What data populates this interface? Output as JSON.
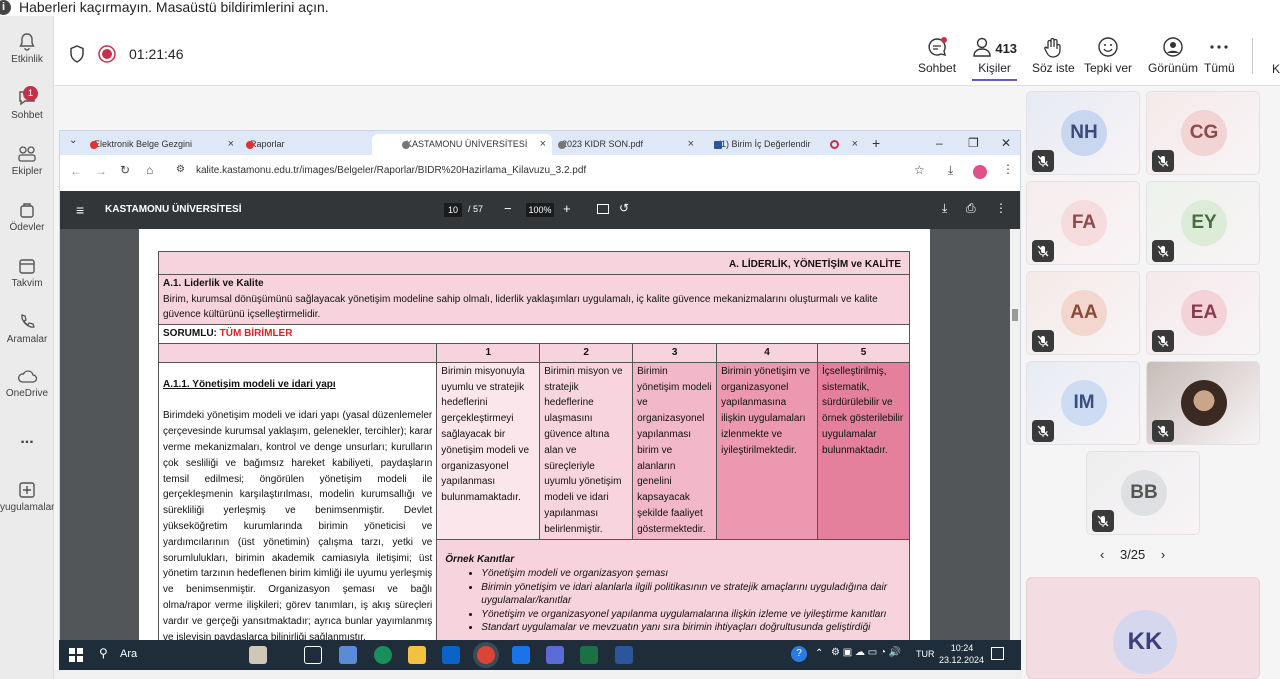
{
  "notification": {
    "text": "Haberleri kaçırmayın. Masaüstü bildirimlerini açın."
  },
  "rail": {
    "items": [
      {
        "label": "Etkinlik"
      },
      {
        "label": "Sohbet",
        "badge": "1"
      },
      {
        "label": "Ekipler"
      },
      {
        "label": "Ödevler"
      },
      {
        "label": "Takvim"
      },
      {
        "label": "Aramalar"
      },
      {
        "label": "OneDrive"
      },
      {
        "label": "..."
      },
      {
        "label": "yugulamalar"
      }
    ]
  },
  "meeting": {
    "timer": "01:21:46",
    "people_count": "413",
    "tools": [
      "Sohbet",
      "Kişiler",
      "Söz iste",
      "Tepki ver",
      "Görünüm",
      "Tümü"
    ],
    "overflow": "K"
  },
  "browser": {
    "tabs": [
      {
        "label": "Elektronik Belge Gezgini",
        "x": "×"
      },
      {
        "label": "Raporlar",
        "x": "×"
      },
      {
        "label": "KASTAMONU ÜNİVERSİTESİ",
        "x": "×"
      },
      {
        "label": "2023 KIDR SON.pdf",
        "x": "×"
      },
      {
        "label": "(1) Birim İç Değerlendir",
        "x": "×"
      }
    ],
    "new_tab": "+",
    "url": "kalite.kastamonu.edu.tr/images/Belgeler/Raporlar/BIDR%20Hazirlama_Kilavuzu_3.2.pdf",
    "window_controls": [
      "–",
      "❐",
      "✕"
    ]
  },
  "pdf": {
    "title": "KASTAMONU ÜNİVERSİTESİ",
    "page_current": "10",
    "page_total": "/ 57",
    "zoom": "100%",
    "section_header": "A. LİDERLİK, YÖNETİŞİM ve KALİTE",
    "subsection_title": "A.1. Liderlik ve Kalite",
    "subsection_desc": "Birim, kurumsal dönüşümünü sağlayacak yönetişim modeline sahip olmalı, liderlik yaklaşımları uygulamalı, iç kalite güvence mekanizmalarını oluşturmalı ve kalite güvence kültürünü içselleştirmelidir.",
    "responsible_label": "SORUMLU:",
    "responsible_value": "TÜM BİRİMLER",
    "levels": [
      "1",
      "2",
      "3",
      "4",
      "5"
    ],
    "criterion_title": "A.1.1. Yönetişim modeli ve idari yapı",
    "criterion_text": "Birimdeki yönetişim modeli ve idari yapı (yasal düzenlemeler çerçevesinde kurumsal yaklaşım, gelenekler, tercihler); karar verme mekanizmaları, kontrol ve denge unsurları; kurulların çok sesliliği ve bağımsız hareket kabiliyeti, paydaşların temsil edilmesi; öngörülen yönetişim modeli ile gerçekleşmenin karşılaştırılması, modelin kurumsallığı ve sürekliliği yerleşmiş ve benimsenmiştir. Devlet yükseköğretim kurumlarında birimin yöneticisi ve yardımcılarının (üst yönetimin) çalışma tarzı, yetki ve sorumlulukları, birimin akademik camiasıyla iletişimi; üst yönetim tarzının hedeflenen birim kimliği ile uyumu yerleşmiş ve benimsenmiştir. Organizasyon şeması ve bağlı olma/rapor verme ilişkileri; görev tanımları, iş akış süreçleri vardır ve gerçeği yansıtmaktadır; ayrıca bunlar yayımlanmış ve işleyişin paydaşlarca bilinirliği sağlanmıştır.",
    "level_texts": [
      "Birimin misyonuyla uyumlu ve stratejik hedeflerini gerçekleştirmeyi sağlayacak bir yönetişim modeli ve organizasyonel yapılanması bulunmamaktadır.",
      "Birimin misyon ve stratejik hedeflerine ulaşmasını güvence altına alan ve süreçleriyle uyumlu yönetişim modeli ve idari yapılanması belirlenmiştir.",
      "Birimin yönetişim modeli ve organizasyonel yapılanması birim ve alanların genelini kapsayacak şekilde faaliyet göstermektedir.",
      "Birimin yönetişim ve organizasyonel yapılanmasına ilişkin uygulamaları izlenmekte ve iyileştirilmektedir.",
      "İçselleştirilmiş, sistematik, sürdürülebilir ve örnek gösterilebilir uygulamalar bulunmaktadır."
    ],
    "evidence_title": "Örnek Kanıtlar",
    "evidence_items": [
      "Yönetişim modeli ve organizasyon şeması",
      "Birimin yönetişim ve idari alanlarla ilgili politikasının ve stratejik amaçlarını uyguladığına dair uygulamalar/kanıtlar",
      "Yönetişim ve organizasyonel yapılanma uygulamalarına ilişkin izleme ve iyileştirme kanıtları",
      "Standart uygulamalar ve mevzuatın yanı sıra birimin ihtiyaçları doğrultusunda geliştirdiği"
    ]
  },
  "taskbar": {
    "search": "Ara",
    "lang": "TUR",
    "time": "10:24",
    "date": "23.12.2024"
  },
  "participants": [
    {
      "initials": "NH",
      "color": "#c9d6f0",
      "text": "#3b4a7a"
    },
    {
      "initials": "CG",
      "color": "#f2d4d4",
      "text": "#8a4b4b"
    },
    {
      "initials": "FA",
      "color": "#f6dcdc",
      "text": "#8d4b4b"
    },
    {
      "initials": "EY",
      "color": "#dcecd8",
      "text": "#4b6b45"
    },
    {
      "initials": "AA",
      "color": "#f3d6ce",
      "text": "#8a4a3b"
    },
    {
      "initials": "EA",
      "color": "#f3d2d8",
      "text": "#8a3b4b"
    },
    {
      "initials": "IM",
      "color": "#cddcf2",
      "text": "#3b4f7a"
    },
    {
      "initials": "",
      "color": "#6b4a3a",
      "text": "#fff"
    },
    {
      "initials": "BB",
      "color": "#dfe0e3",
      "text": "#555"
    }
  ],
  "pager": {
    "text": "3/25"
  },
  "speaker": {
    "initials": "KK"
  }
}
